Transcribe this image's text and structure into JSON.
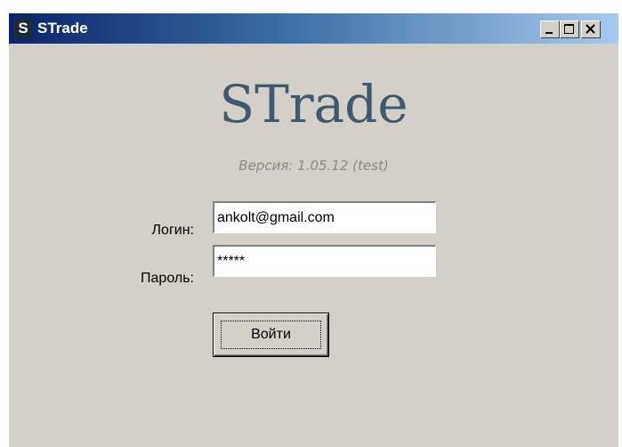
{
  "window": {
    "icon_letter": "S",
    "title": "STrade"
  },
  "app": {
    "title": "STrade",
    "version": "Версия: 1.05.12 (test)"
  },
  "form": {
    "login_label": "Логин:",
    "login_value": "ankolt@gmail.com",
    "password_label": "Пароль:",
    "password_value": "*****",
    "submit_label": "Войти"
  },
  "colors": {
    "window_bg": "#d4d0c8",
    "title_color": "#3d5a73",
    "titlebar_start": "#0a246a",
    "titlebar_end": "#a6caf0"
  },
  "icons": {
    "app": "app-logo-icon",
    "minimize": "minimize-icon",
    "maximize": "maximize-icon",
    "close": "close-icon"
  }
}
